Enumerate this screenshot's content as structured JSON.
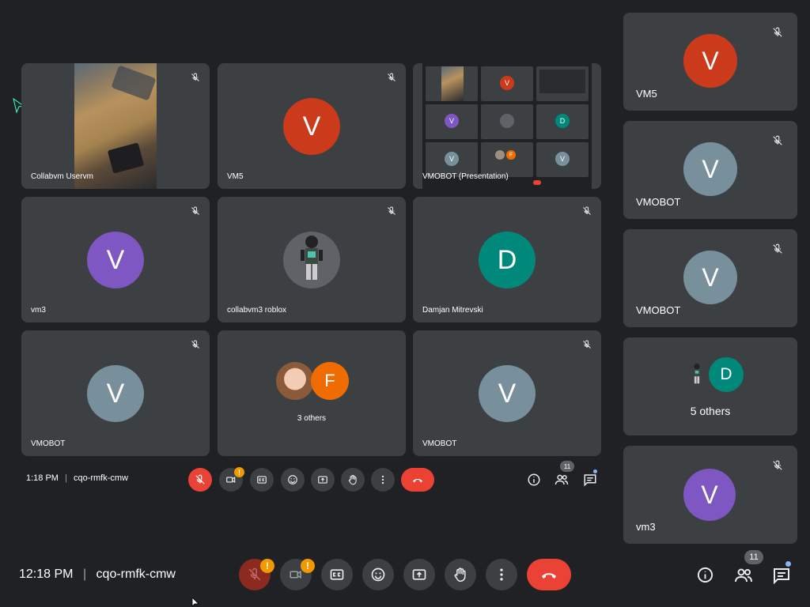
{
  "inner_meeting": {
    "tiles": [
      {
        "name": "Collabvm Uservm"
      },
      {
        "name": "VM5",
        "initial": "V"
      },
      {
        "name": "VMOBOT (Presentation)"
      },
      {
        "name": "vm3",
        "initial": "V"
      },
      {
        "name": "collabvm3 roblox"
      },
      {
        "name": "Damjan Mitrevski",
        "initial": "D"
      },
      {
        "name": "VMOBOT",
        "initial": "V"
      },
      {
        "name": "3 others",
        "initial": "F"
      },
      {
        "name": "VMOBOT",
        "initial": "V"
      }
    ],
    "bar": {
      "time": "1:18 PM",
      "code": "cqo-rmfk-cmw",
      "people_count": "11"
    }
  },
  "sidebar": {
    "tiles": [
      {
        "name": "VM5",
        "initial": "V"
      },
      {
        "name": "VMOBOT",
        "initial": "V"
      },
      {
        "name": "VMOBOT",
        "initial": "V"
      },
      {
        "name": "5 others",
        "initial": "D"
      },
      {
        "name": "vm3",
        "initial": "V"
      }
    ]
  },
  "bottom_bar": {
    "time": "12:18 PM",
    "code": "cqo-rmfk-cmw",
    "people_count": "11",
    "warning_glyph": "!"
  },
  "colors": {
    "vm5": "#cb3a1a",
    "vmobot": "#78909c",
    "vm3": "#7e57c2",
    "damjan": "#00897b",
    "f": "#ef6c00",
    "end_call": "#ea4335"
  }
}
